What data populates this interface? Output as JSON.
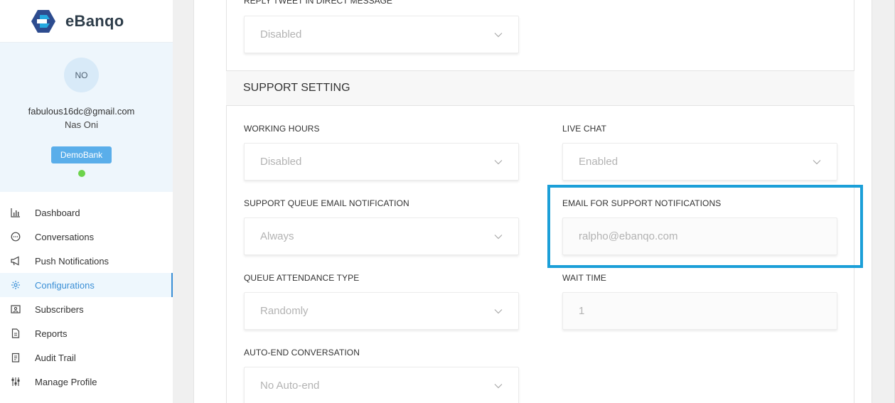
{
  "brand": {
    "name": "eBanqo",
    "logo_colors": [
      "#2d4c8f",
      "#26a9e0"
    ]
  },
  "profile": {
    "initials": "NO",
    "email": "fabulous16dc@gmail.com",
    "name": "Nas Oni",
    "bank": "DemoBank",
    "status_color": "#6cd34b"
  },
  "nav": [
    {
      "label": "Dashboard",
      "icon": "bar-chart-icon"
    },
    {
      "label": "Conversations",
      "icon": "chat-bubble-icon"
    },
    {
      "label": "Push Notifications",
      "icon": "megaphone-icon"
    },
    {
      "label": "Configurations",
      "icon": "gear-icon",
      "active": true
    },
    {
      "label": "Subscribers",
      "icon": "contact-card-icon"
    },
    {
      "label": "Reports",
      "icon": "document-icon"
    },
    {
      "label": "Audit Trail",
      "icon": "clipboard-icon"
    },
    {
      "label": "Manage Profile",
      "icon": "sliders-icon"
    }
  ],
  "top_field": {
    "label": "REPLY TWEET IN DIRECT MESSAGE",
    "value": "Disabled"
  },
  "support": {
    "title": "SUPPORT SETTING",
    "working_hours": {
      "label": "WORKING HOURS",
      "value": "Disabled"
    },
    "live_chat": {
      "label": "LIVE CHAT",
      "value": "Enabled"
    },
    "queue_email_notification": {
      "label": "SUPPORT QUEUE EMAIL NOTIFICATION",
      "value": "Always"
    },
    "email_for_notifications": {
      "label": "EMAIL FOR SUPPORT NOTIFICATIONS",
      "placeholder": "ralpho@ebanqo.com"
    },
    "queue_attendance_type": {
      "label": "QUEUE ATTENDANCE TYPE",
      "value": "Randomly"
    },
    "wait_time": {
      "label": "WAIT TIME",
      "value": "1"
    },
    "auto_end": {
      "label": "AUTO-END CONVERSATION",
      "value": "No Auto-end"
    }
  },
  "colors": {
    "accent": "#3a8fd6",
    "highlight": "#1b9fd8",
    "badge": "#5aaeea"
  }
}
